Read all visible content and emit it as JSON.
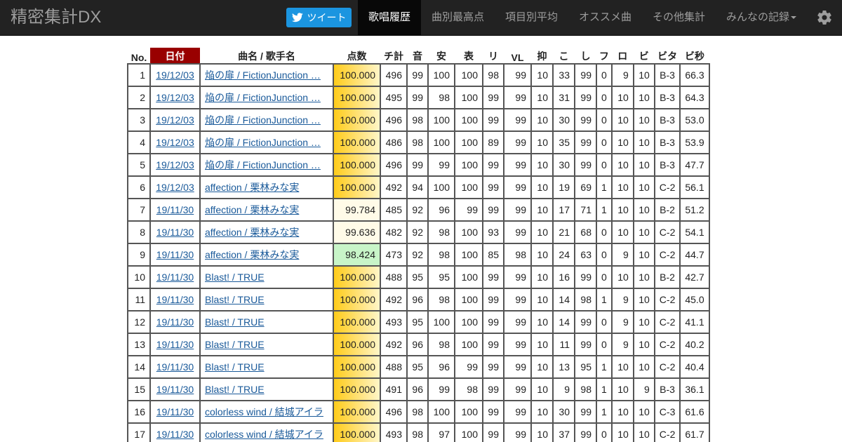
{
  "nav": {
    "brand": "精密集計DX",
    "tweet": "ツイート",
    "items": [
      "歌唱履歴",
      "曲別最高点",
      "項目別平均",
      "オススメ曲",
      "その他集計",
      "みんなの記録"
    ]
  },
  "table": {
    "headers": [
      "No.",
      "日付",
      "曲名 / 歌手名",
      "点数",
      "チ計",
      "音",
      "安",
      "表",
      "リ",
      "VL",
      "抑",
      "こ",
      "し",
      "フ",
      "ロ",
      "ビ",
      "ビタ",
      "ビ秒"
    ],
    "rows": [
      [
        "1",
        "19/12/03",
        "焔の扉 / FictionJunction …",
        "100.000",
        "496",
        "99",
        "100",
        "100",
        "98",
        "99",
        "10",
        "33",
        "99",
        "0",
        "9",
        "10",
        "B-3",
        "66.3"
      ],
      [
        "2",
        "19/12/03",
        "焔の扉 / FictionJunction …",
        "100.000",
        "495",
        "99",
        "98",
        "100",
        "99",
        "99",
        "10",
        "31",
        "99",
        "0",
        "10",
        "10",
        "B-3",
        "64.3"
      ],
      [
        "3",
        "19/12/03",
        "焔の扉 / FictionJunction …",
        "100.000",
        "496",
        "98",
        "100",
        "100",
        "99",
        "99",
        "10",
        "30",
        "99",
        "0",
        "10",
        "10",
        "B-3",
        "53.0"
      ],
      [
        "4",
        "19/12/03",
        "焔の扉 / FictionJunction …",
        "100.000",
        "486",
        "98",
        "100",
        "100",
        "89",
        "99",
        "10",
        "35",
        "99",
        "0",
        "10",
        "10",
        "B-3",
        "53.9"
      ],
      [
        "5",
        "19/12/03",
        "焔の扉 / FictionJunction …",
        "100.000",
        "496",
        "99",
        "99",
        "100",
        "99",
        "99",
        "10",
        "30",
        "99",
        "0",
        "10",
        "10",
        "B-3",
        "47.7"
      ],
      [
        "6",
        "19/12/03",
        "affection / 栗林みな実",
        "100.000",
        "492",
        "94",
        "100",
        "100",
        "99",
        "99",
        "10",
        "19",
        "69",
        "1",
        "10",
        "10",
        "C-2",
        "56.1"
      ],
      [
        "7",
        "19/11/30",
        "affection / 栗林みな実",
        "99.784",
        "485",
        "92",
        "96",
        "99",
        "99",
        "99",
        "10",
        "17",
        "71",
        "1",
        "10",
        "10",
        "B-2",
        "51.2"
      ],
      [
        "8",
        "19/11/30",
        "affection / 栗林みな実",
        "99.636",
        "482",
        "92",
        "98",
        "100",
        "93",
        "99",
        "10",
        "21",
        "68",
        "0",
        "10",
        "10",
        "C-2",
        "54.1"
      ],
      [
        "9",
        "19/11/30",
        "affection / 栗林みな実",
        "98.424",
        "473",
        "92",
        "98",
        "100",
        "85",
        "98",
        "10",
        "24",
        "63",
        "0",
        "9",
        "10",
        "C-2",
        "44.7"
      ],
      [
        "10",
        "19/11/30",
        "Blast! / TRUE",
        "100.000",
        "488",
        "95",
        "95",
        "100",
        "99",
        "99",
        "10",
        "16",
        "99",
        "0",
        "10",
        "10",
        "B-2",
        "42.7"
      ],
      [
        "11",
        "19/11/30",
        "Blast! / TRUE",
        "100.000",
        "492",
        "96",
        "98",
        "100",
        "99",
        "99",
        "10",
        "14",
        "98",
        "1",
        "9",
        "10",
        "C-2",
        "45.0"
      ],
      [
        "12",
        "19/11/30",
        "Blast! / TRUE",
        "100.000",
        "493",
        "95",
        "100",
        "100",
        "99",
        "99",
        "10",
        "14",
        "99",
        "0",
        "9",
        "10",
        "C-2",
        "41.1"
      ],
      [
        "13",
        "19/11/30",
        "Blast! / TRUE",
        "100.000",
        "492",
        "96",
        "98",
        "100",
        "99",
        "99",
        "10",
        "11",
        "99",
        "0",
        "9",
        "10",
        "C-2",
        "40.2"
      ],
      [
        "14",
        "19/11/30",
        "Blast! / TRUE",
        "100.000",
        "488",
        "95",
        "96",
        "99",
        "99",
        "99",
        "10",
        "13",
        "95",
        "1",
        "10",
        "10",
        "C-2",
        "40.4"
      ],
      [
        "15",
        "19/11/30",
        "Blast! / TRUE",
        "100.000",
        "491",
        "96",
        "99",
        "98",
        "99",
        "99",
        "10",
        "9",
        "98",
        "1",
        "10",
        "9",
        "B-3",
        "36.1"
      ],
      [
        "16",
        "19/11/30",
        "colorless wind / 結城アイラ",
        "100.000",
        "496",
        "98",
        "100",
        "100",
        "99",
        "99",
        "10",
        "30",
        "99",
        "1",
        "10",
        "10",
        "C-3",
        "61.6"
      ],
      [
        "17",
        "19/11/30",
        "colorless wind / 結城アイラ",
        "100.000",
        "493",
        "98",
        "97",
        "100",
        "99",
        "99",
        "10",
        "37",
        "99",
        "0",
        "10",
        "10",
        "C-2",
        "61.7"
      ]
    ]
  }
}
